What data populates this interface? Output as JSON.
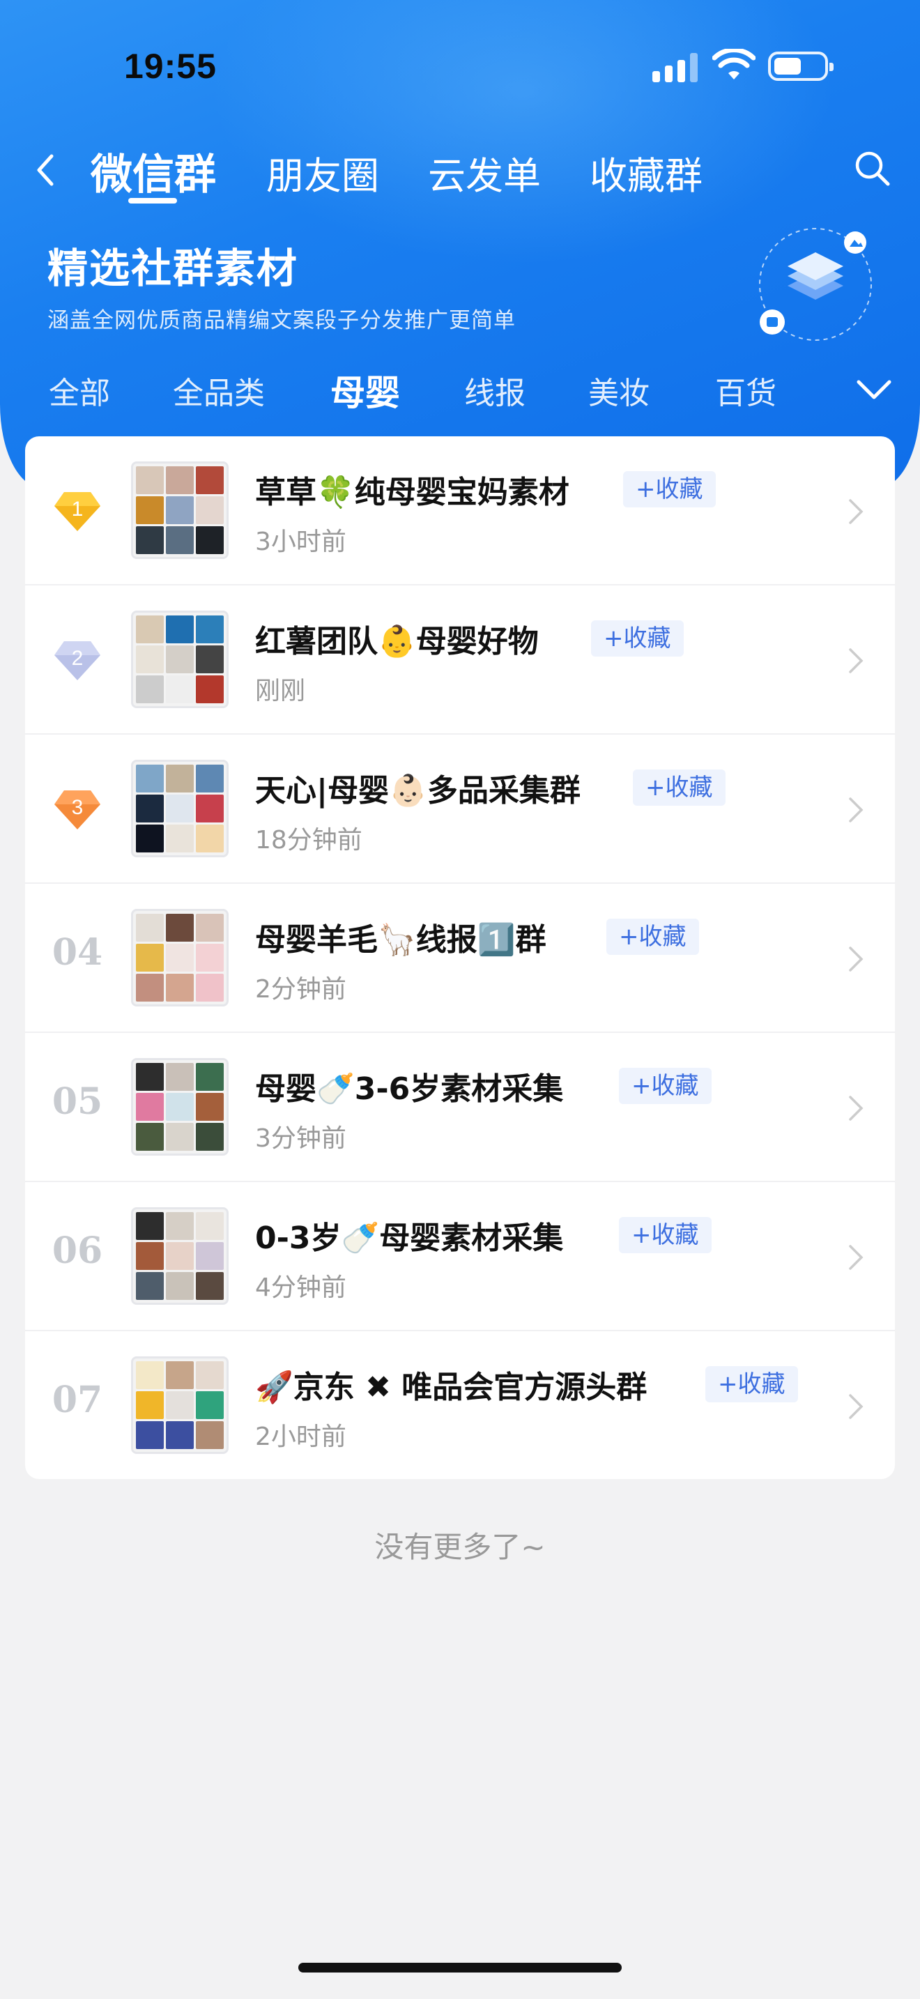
{
  "status_bar": {
    "time": "19:55"
  },
  "nav": {
    "tabs": [
      "微信群",
      "朋友圈",
      "云发单",
      "收藏群"
    ],
    "active_index": 0
  },
  "banner": {
    "title": "精选社群素材",
    "subtitle": "涵盖全网优质商品精编文案段子分发推广更简单"
  },
  "categories": {
    "items": [
      "全部",
      "全品类",
      "母婴",
      "线报",
      "美妆",
      "百货"
    ],
    "active_index": 2
  },
  "groups": [
    {
      "rank": "1",
      "name": "草草🍀纯母婴宝妈素材",
      "time": "3小时前",
      "fav": "+收藏",
      "badge_color": "#f5b51d"
    },
    {
      "rank": "2",
      "name": "红薯团队👶母婴好物",
      "time": "刚刚",
      "fav": "+收藏",
      "badge_color": "#b9c1e8"
    },
    {
      "rank": "3",
      "name": "天心|母婴👶🏻多品采集群",
      "time": "18分钟前",
      "fav": "+收藏",
      "badge_color": "#f58a3a"
    },
    {
      "rank": "04",
      "name": "母婴羊毛🦙线报1️⃣群",
      "time": "2分钟前",
      "fav": "+收藏"
    },
    {
      "rank": "05",
      "name": "母婴🍼3-6岁素材采集",
      "time": "3分钟前",
      "fav": "+收藏"
    },
    {
      "rank": "06",
      "name": "0-3岁🍼母婴素材采集",
      "time": "4分钟前",
      "fav": "+收藏"
    },
    {
      "rank": "07",
      "name": "🚀京东 ✖ 唯品会官方源头群",
      "time": "2小时前",
      "fav": "+收藏"
    }
  ],
  "footer": {
    "no_more": "没有更多了~"
  },
  "colors": {
    "primary": "#1a7ff0",
    "fav_text": "#3d6fe0",
    "fav_bg": "#eef3fd"
  }
}
